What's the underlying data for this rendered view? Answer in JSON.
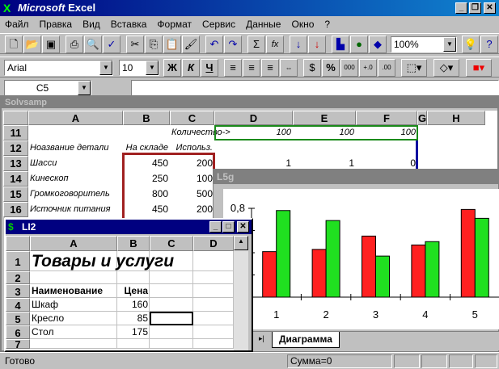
{
  "app": {
    "title_brand": "Microsoft",
    "title_app": "Excel"
  },
  "menu": [
    "Файл",
    "Правка",
    "Вид",
    "Вставка",
    "Формат",
    "Сервис",
    "Данные",
    "Окно",
    "?"
  ],
  "toolbar": {
    "zoom": "100%",
    "font": "Arial",
    "size": "10",
    "bold": "Ж",
    "italic": "К",
    "underline": "Ч",
    "percent": "%",
    "thousands": "000",
    "sum": "Σ",
    "fx": "fx"
  },
  "formula": {
    "name_box": "C5",
    "value": ""
  },
  "solvsamp": {
    "title": "Solvsamp",
    "columns": [
      "A",
      "B",
      "C",
      "D",
      "E",
      "F",
      "G",
      "H"
    ],
    "rows": [
      {
        "n": "11",
        "a": "",
        "b": "",
        "c": "Количество->",
        "d": "100",
        "e": "100",
        "f": "100"
      },
      {
        "n": "12",
        "a": "Ноазвание детали",
        "b": "На складе",
        "c": "Использ.",
        "d": "",
        "e": "",
        "f": ""
      },
      {
        "n": "13",
        "a": "Шасси",
        "b": "450",
        "c": "200",
        "d": "1",
        "e": "1",
        "f": "0"
      },
      {
        "n": "14",
        "a": "Кинескоп",
        "b": "250",
        "c": "100"
      },
      {
        "n": "15",
        "a": "Громкоговоритель",
        "b": "800",
        "c": "500"
      },
      {
        "n": "16",
        "a": "Источник питания",
        "b": "450",
        "c": "200"
      }
    ]
  },
  "chart_window": {
    "title": "L5g",
    "tab": "Диаграмма"
  },
  "chart_data": {
    "type": "bar",
    "categories": [
      "1",
      "2",
      "3",
      "4",
      "5"
    ],
    "series": [
      {
        "name": "red",
        "color": "#ff2020",
        "values": [
          0.41,
          0.43,
          0.55,
          0.47,
          0.79
        ]
      },
      {
        "name": "green",
        "color": "#20e020",
        "values": [
          0.78,
          0.69,
          0.37,
          0.5,
          0.71
        ]
      }
    ],
    "ylim": [
      0,
      0.8
    ],
    "ytick_label": "0,8"
  },
  "li2": {
    "title": "LI2",
    "columns": [
      "A",
      "B",
      "C",
      "D"
    ],
    "rows": [
      {
        "n": "1",
        "a": "Товары и услуги",
        "b": ""
      },
      {
        "n": "2",
        "a": "",
        "b": ""
      },
      {
        "n": "3",
        "a": "Наименование",
        "b": "Цена"
      },
      {
        "n": "4",
        "a": "Шкаф",
        "b": "160"
      },
      {
        "n": "5",
        "a": "Кресло",
        "b": "85"
      },
      {
        "n": "6",
        "a": "Стол",
        "b": "175"
      },
      {
        "n": "7",
        "a": "",
        "b": ""
      }
    ]
  },
  "status": {
    "ready": "Готово",
    "sum": "Сумма=0"
  }
}
